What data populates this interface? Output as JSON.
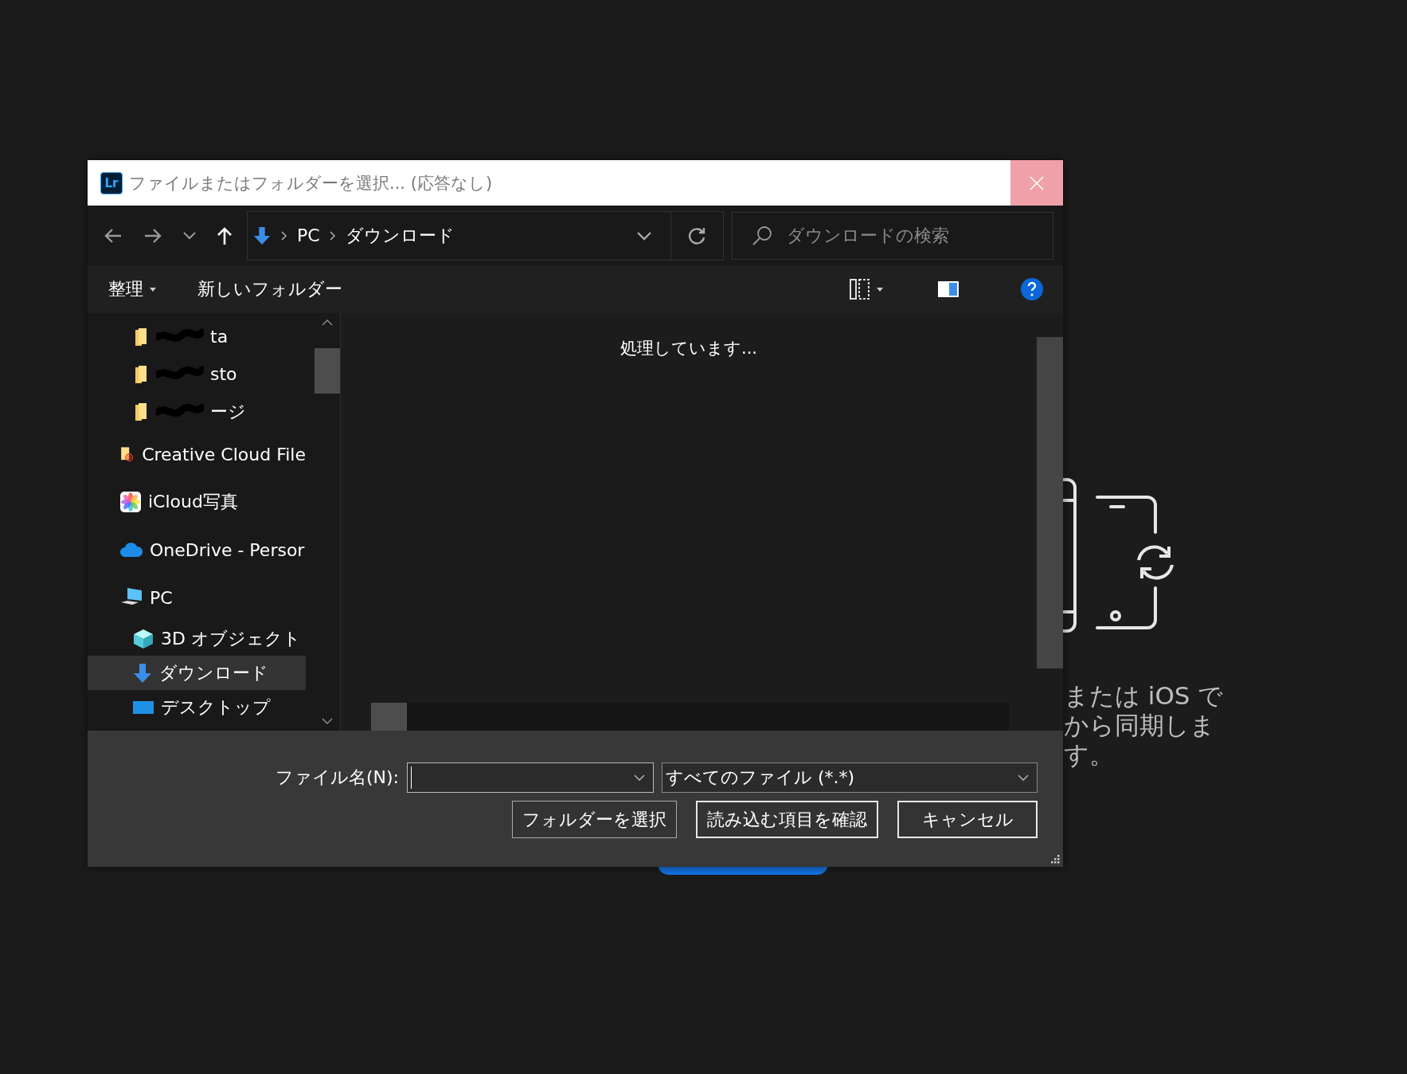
{
  "window": {
    "app_badge": "Lr",
    "title": "ファイルまたはフォルダーを選択... (応答なし)"
  },
  "nav": {
    "breadcrumb": [
      "PC",
      "ダウンロード"
    ],
    "search": {
      "placeholder": "ダウンロードの検索"
    }
  },
  "command_bar": {
    "organize": "整理",
    "new_folder": "新しいフォルダー"
  },
  "sidebar": {
    "items": [
      {
        "label": "ta",
        "kind": "folder",
        "scribbled": true,
        "selected": false
      },
      {
        "label": "sto",
        "kind": "folder",
        "scribbled": true,
        "selected": false
      },
      {
        "label": "ージ",
        "kind": "folder",
        "scribbled": true,
        "selected": false
      },
      {
        "label": "Creative Cloud File",
        "kind": "cloud-folder",
        "scribbled": false,
        "selected": false
      },
      {
        "label": "iCloud写真",
        "kind": "photos",
        "scribbled": false,
        "selected": false
      },
      {
        "label": "OneDrive - Persor",
        "kind": "onedrive",
        "scribbled": false,
        "selected": false
      },
      {
        "label": "PC",
        "kind": "pc",
        "scribbled": false,
        "selected": false,
        "children": [
          {
            "label": "3D オブジェクト",
            "kind": "cube",
            "scribbled": false,
            "selected": false
          },
          {
            "label": "ダウンロード",
            "kind": "download",
            "scribbled": false,
            "selected": true
          },
          {
            "label": "デスクトップ",
            "kind": "desktop",
            "scribbled": false,
            "selected": false
          }
        ]
      }
    ]
  },
  "content": {
    "status": "処理しています..."
  },
  "footer": {
    "filename_label": "ファイル名(N):",
    "filetype": "すべてのファイル (*.*)",
    "buttons": [
      {
        "label": "フォルダーを選択",
        "highlighted": false
      },
      {
        "label": "読み込む項目を確認",
        "highlighted": true
      },
      {
        "label": "キャンセル",
        "highlighted": true
      }
    ]
  },
  "background": {
    "lines": [
      "または iOS で",
      "から同期しま",
      "す。"
    ]
  }
}
